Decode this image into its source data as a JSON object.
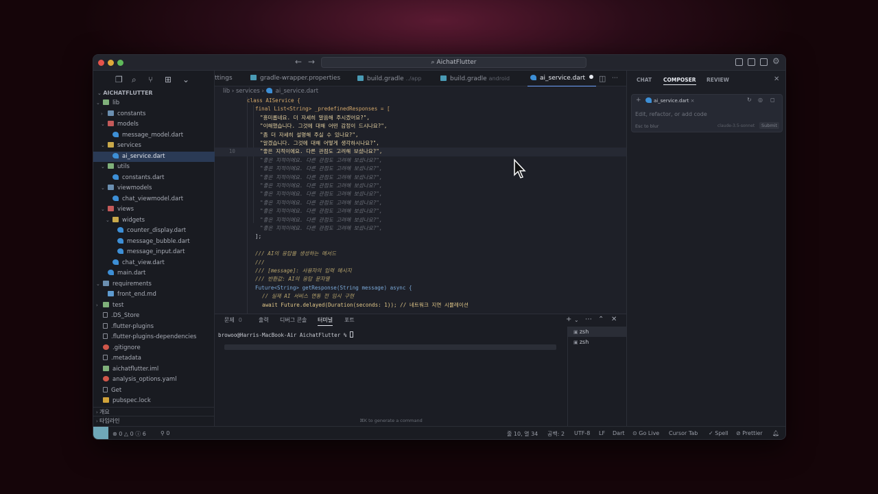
{
  "titlebar": {
    "search_text": "AichatFlutter"
  },
  "sidebar": {
    "explorer_title": "AICHATFLUTTER",
    "tree": [
      {
        "label": "lib",
        "depth": 1,
        "type": "folder-grn",
        "chev": "⌄"
      },
      {
        "label": "constants",
        "depth": 2,
        "type": "folder-ic",
        "chev": "›"
      },
      {
        "label": "models",
        "depth": 2,
        "type": "folder-red",
        "chev": "⌄"
      },
      {
        "label": "message_model.dart",
        "depth": 3,
        "type": "dart"
      },
      {
        "label": "services",
        "depth": 2,
        "type": "folder-yel",
        "chev": "⌄"
      },
      {
        "label": "ai_service.dart",
        "depth": 3,
        "type": "dart",
        "selected": true
      },
      {
        "label": "utils",
        "depth": 2,
        "type": "folder-grn",
        "chev": "⌄"
      },
      {
        "label": "constants.dart",
        "depth": 3,
        "type": "dart"
      },
      {
        "label": "viewmodels",
        "depth": 2,
        "type": "folder-ic",
        "chev": "⌄"
      },
      {
        "label": "chat_viewmodel.dart",
        "depth": 3,
        "type": "dart"
      },
      {
        "label": "views",
        "depth": 2,
        "type": "folder-red",
        "chev": "⌄"
      },
      {
        "label": "widgets",
        "depth": 3,
        "type": "folder-yel",
        "chev": "⌄"
      },
      {
        "label": "counter_display.dart",
        "depth": 4,
        "type": "dart"
      },
      {
        "label": "message_bubble.dart",
        "depth": 4,
        "type": "dart"
      },
      {
        "label": "message_input.dart",
        "depth": 4,
        "type": "dart"
      },
      {
        "label": "chat_view.dart",
        "depth": 3,
        "type": "dart"
      },
      {
        "label": "main.dart",
        "depth": 2,
        "type": "dart"
      },
      {
        "label": "requirements",
        "depth": 1,
        "type": "folder-ic",
        "chev": "⌄"
      },
      {
        "label": "front_end.md",
        "depth": 2,
        "type": "md"
      },
      {
        "label": "test",
        "depth": 1,
        "type": "folder-grn",
        "chev": "›"
      },
      {
        "label": ".DS_Store",
        "depth": 1,
        "type": "file"
      },
      {
        "label": ".flutter-plugins",
        "depth": 1,
        "type": "file"
      },
      {
        "label": ".flutter-plugins-dependencies",
        "depth": 1,
        "type": "file"
      },
      {
        "label": ".gitignore",
        "depth": 1,
        "type": "red"
      },
      {
        "label": ".metadata",
        "depth": 1,
        "type": "file"
      },
      {
        "label": "aichatflutter.iml",
        "depth": 1,
        "type": "folder-grn"
      },
      {
        "label": "analysis_options.yaml",
        "depth": 1,
        "type": "red"
      },
      {
        "label": "Get",
        "depth": 1,
        "type": "file"
      },
      {
        "label": "pubspec.lock",
        "depth": 1,
        "type": "lock"
      }
    ],
    "outline_label": "개요",
    "timeline_label": "타임라인"
  },
  "tabs": [
    {
      "label": "ttings",
      "sub": ""
    },
    {
      "label": "gradle-wrapper.properties",
      "sub": ""
    },
    {
      "label": "build.gradle",
      "sub": "../app"
    },
    {
      "label": "build.gradle",
      "sub": "android"
    },
    {
      "label": "ai_service.dart",
      "sub": "",
      "active": true
    }
  ],
  "breadcrumb": {
    "lib": "lib",
    "services": "services",
    "file": "ai_service.dart"
  },
  "code": {
    "class_line": "class AIService {",
    "list_decl": "final List<String> _predefinedResponses = [",
    "responses": [
      "\"흥미롭네요. 더 자세히 말씀해 주시겠어요?\",",
      "\"이해했습니다. 그것에 대해 어떤 감정이 드시나요?\",",
      "\"좀 더 자세히 설명해 주실 수 있나요?\",",
      "\"알겠습니다. 그것에 대해 어떻게 생각하시나요?\",",
      "\"좋은 지적이에요. 다른 관점도 고려해 보셨나요?\","
    ],
    "line_number": "10",
    "ghost_line": "\"좋은 지적이에요. 다른 관점도 고려해 보셨나요?\",",
    "close_bracket": "];",
    "doc1": "/// AI의 응답을 생성하는 메서드",
    "doc2": "///",
    "doc3": "/// [message]: 사용자의 입력 메시지",
    "doc4": "/// 반환값: AI의 응답 문자열",
    "method_sig": "Future<String> getResponse(String message) async {",
    "cmt1": "// 실제 AI 서비스 연동 전 임시 구현",
    "await_line": "await Future.delayed(Duration(seconds: 1)); // 네트워크 지연 시뮬레이션"
  },
  "panel": {
    "tabs": [
      {
        "label": "문제",
        "count": "0"
      },
      {
        "label": "출력",
        "count": ""
      },
      {
        "label": "디버그 콘솔",
        "count": ""
      },
      {
        "label": "터미널",
        "count": "",
        "active": true
      },
      {
        "label": "포트",
        "count": ""
      }
    ],
    "prompt": "browoo@Harris-MacBook-Air AichatFlutter % ",
    "terminals": [
      "zsh",
      "zsh"
    ],
    "hint": "⌘K to generate a command"
  },
  "chat": {
    "tabs": [
      "CHAT",
      "COMPOSER",
      "REVIEW"
    ],
    "active_tab": "COMPOSER",
    "file_chip": "ai_service.dart",
    "placeholder": "Edit, refactor, or add code",
    "esc_hint": "Esc to blur",
    "model": "claude-3.5-sonnet",
    "submit": "Submit"
  },
  "statusbar": {
    "errors": "0",
    "warnings": "0",
    "info": "6",
    "ports": "0",
    "position": "줄 10, 열 34",
    "spaces": "공백: 2",
    "encoding": "UTF-8",
    "eol": "LF",
    "language": "Dart",
    "golive": "Go Live",
    "cursor_tab": "Cursor Tab",
    "spell": "Spell",
    "prettier": "Prettier"
  }
}
